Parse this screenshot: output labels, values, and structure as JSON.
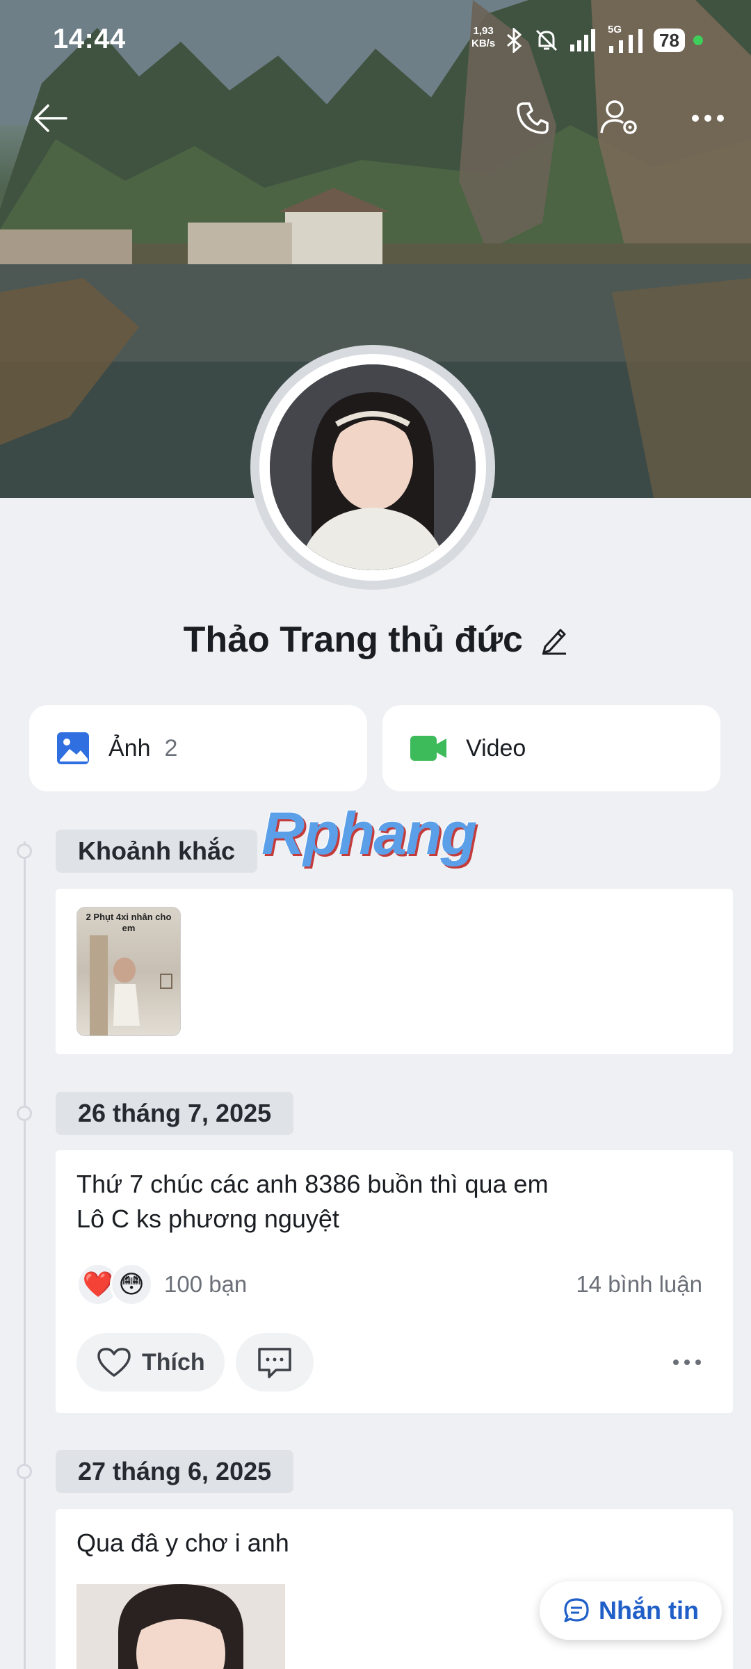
{
  "status_bar": {
    "time": "14:44",
    "net_speed_line1": "1,93",
    "net_speed_line2": "KB/s",
    "network_label": "5G",
    "battery": "78"
  },
  "profile": {
    "name": "Thảo Trang thủ đức"
  },
  "media": [
    {
      "label": "Ảnh",
      "count": "2",
      "icon": "image-icon",
      "color": "#2f6fe0"
    },
    {
      "label": "Video",
      "count": "",
      "icon": "video-icon",
      "color": "#3dbb5a"
    }
  ],
  "watermark": "Rphang",
  "moments": {
    "tag": "Khoảnh khắc",
    "thumb_caption": "2 Phụt 4xi nhân cho em"
  },
  "posts": [
    {
      "date": "26 tháng 7, 2025",
      "text_line1": "Thứ 7 chúc các anh 8386 buồn thì qua em",
      "text_line2": "Lô C ks phương nguyệt",
      "reactions": [
        "❤️",
        "😳"
      ],
      "reaction_count": "100 bạn",
      "comment_count": "14 bình luận",
      "like_label": "Thích"
    },
    {
      "date": "27 tháng 6, 2025",
      "text_line1": "Qua đâ y chơ i anh"
    }
  ],
  "fab": {
    "label": "Nhắn tin"
  },
  "colors": {
    "accent": "#1f5fc7",
    "background": "#eef0f4"
  }
}
